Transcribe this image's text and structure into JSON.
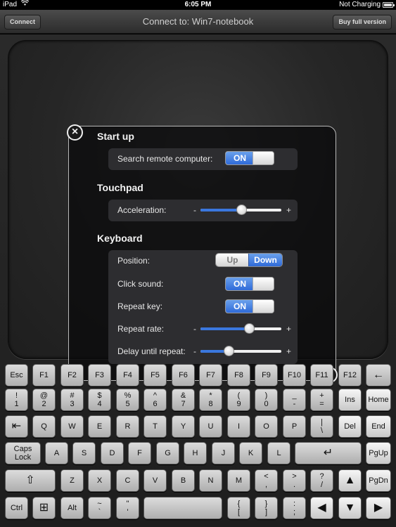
{
  "status_bar": {
    "device": "iPad",
    "time": "6:05 PM",
    "battery": "Not Charging"
  },
  "nav": {
    "connect_label": "Connect",
    "title": "Connect to: Win7-notebook",
    "buy_label": "Buy full version"
  },
  "settings": {
    "sections": {
      "startup": "Start up",
      "touchpad": "Touchpad",
      "keyboard": "Keyboard"
    },
    "search_label": "Search remote computer:",
    "search_state": "ON",
    "acceleration_label": "Acceleration:",
    "acceleration_value": 0.5,
    "position_label": "Position:",
    "position_options": [
      "Up",
      "Down"
    ],
    "position_selected": "Down",
    "click_sound_label": "Click sound:",
    "click_sound_state": "ON",
    "repeat_key_label": "Repeat key:",
    "repeat_key_state": "ON",
    "repeat_rate_label": "Repeat rate:",
    "repeat_rate_value": 0.6,
    "delay_label": "Delay until repeat:",
    "delay_value": 0.35,
    "slider_minus": "-",
    "slider_plus": "+",
    "close_icon": "close-icon",
    "confirm_icon": "checkmark-icon"
  },
  "keyboard": {
    "row1": [
      "Esc",
      "F1",
      "F2",
      "F3",
      "F4",
      "F5",
      "F6",
      "F7",
      "F8",
      "F9",
      "F10",
      "F11",
      "F12",
      "←"
    ],
    "row2_top": [
      "!",
      "@",
      "#",
      "$",
      "%",
      "^",
      "&",
      "*",
      "(",
      ")",
      "_",
      "+",
      "Ins",
      "Home"
    ],
    "row2_bottom": [
      "1",
      "2",
      "3",
      "4",
      "5",
      "6",
      "7",
      "8",
      "9",
      "0",
      "-",
      "=",
      "",
      ""
    ],
    "row3": [
      "⇤",
      "Q",
      "W",
      "E",
      "R",
      "T",
      "Y",
      "U",
      "I",
      "O",
      "P",
      "|",
      "Del",
      "End"
    ],
    "row3_extra": "\\",
    "row4": [
      "Caps",
      "A",
      "S",
      "D",
      "F",
      "G",
      "H",
      "J",
      "K",
      "L",
      "↵",
      "PgUp"
    ],
    "row4_caps2": "Lock",
    "row5": [
      "⇧",
      "Z",
      "X",
      "C",
      "V",
      "B",
      "N",
      "M",
      "<",
      ">",
      "?",
      "▲",
      "PgDn"
    ],
    "row5_bottom": [
      "",
      ",",
      ".",
      "/"
    ],
    "row6": [
      "Ctrl",
      "⊞",
      "Alt",
      "~",
      "\"",
      "",
      "{",
      "}",
      ":",
      "◀",
      "▼",
      "▶"
    ],
    "row6_bottom": [
      "`",
      "'",
      "[",
      "]",
      ";"
    ]
  }
}
